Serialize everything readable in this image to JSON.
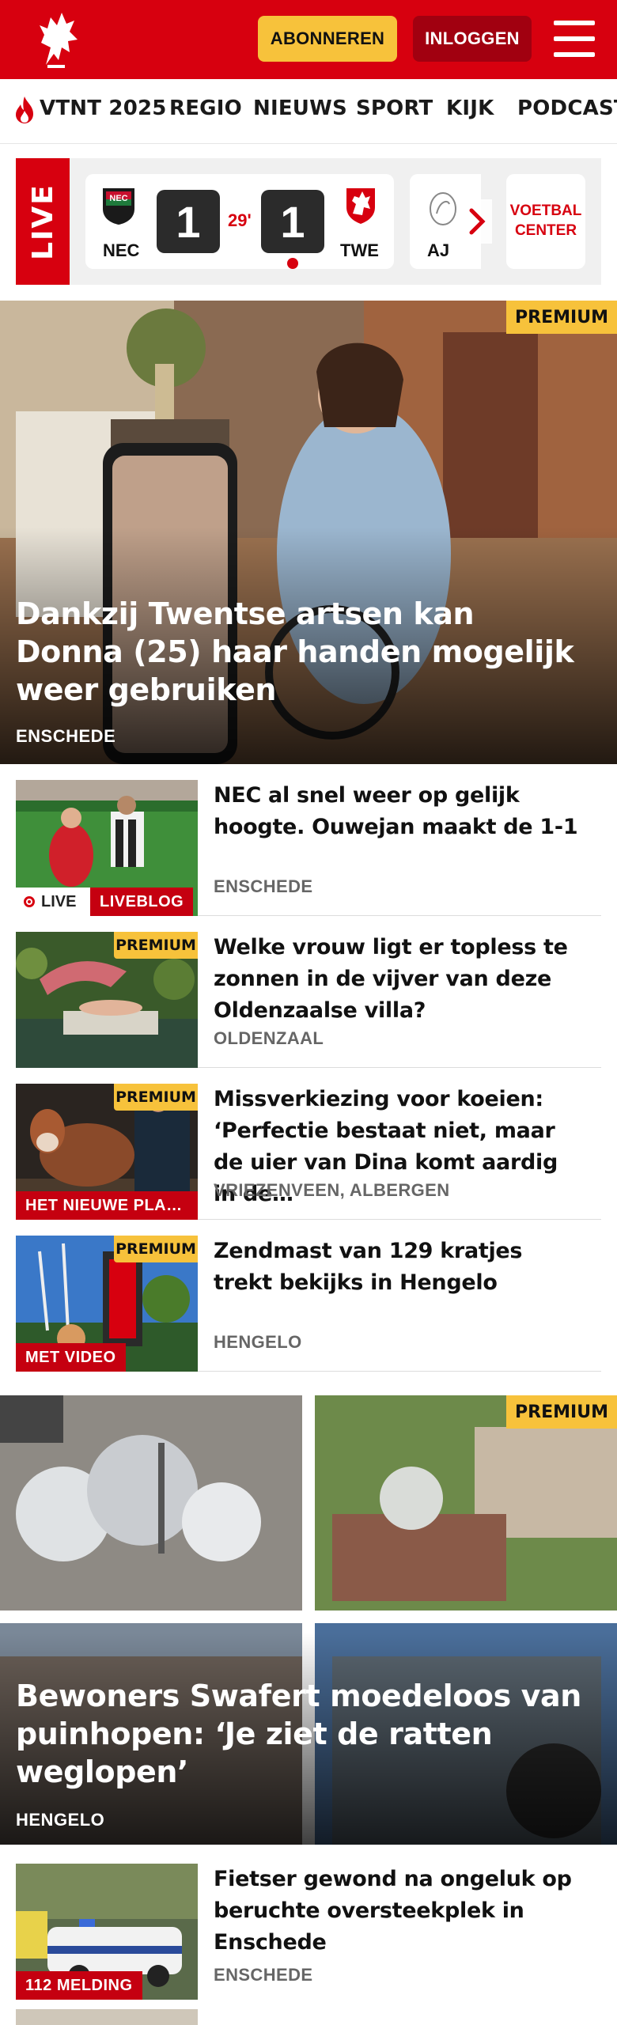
{
  "header": {
    "subscribe_label": "ABONNEREN",
    "login_label": "INLOGGEN",
    "brand_color": "#d7000f"
  },
  "nav": {
    "items": [
      "VTNT 2025",
      "REGIO",
      "NIEUWS",
      "SPORT",
      "KIJK",
      "PODCAST"
    ]
  },
  "live": {
    "label": "LIVE",
    "match": {
      "home": "NEC",
      "away": "TWE",
      "home_score": "1",
      "away_score": "1",
      "minute": "29'"
    },
    "next_team": "AJ",
    "voetbal_center": "VOETBAL CENTER"
  },
  "hero": {
    "badge": "PREMIUM",
    "title": "Dankzij Twentse artsen kan Donna (25) haar handen mogelijk weer gebruiken",
    "region": "ENSCHEDE"
  },
  "articles": [
    {
      "title": "NEC al snel weer op gelijk hoogte. Ouwejan maakt de 1-1",
      "region": "ENSCHEDE",
      "live": "LIVE",
      "label": "LIVEBLOG"
    },
    {
      "badge": "PREMIUM",
      "title": "Welke vrouw ligt er topless te zonnen in de vijver van deze Oldenzaalse villa?",
      "region": "OLDENZAAL"
    },
    {
      "badge": "PREMIUM",
      "title": "Missverkiezing voor koeien: ‘Perfectie bestaat niet, maar de uier van Dina komt aardig in de…",
      "region": "VRIEZENVEEN, ALBERGEN",
      "label": "HET NIEUWE PLA…"
    },
    {
      "badge": "PREMIUM",
      "title": "Zendmast van 129 kratjes trekt bekijks in Hengelo",
      "region": "HENGELO",
      "label": "MET VIDEO"
    }
  ],
  "collage": {
    "badge": "PREMIUM",
    "title": "Bewoners Swafert moedeloos van puinhopen: ‘Je ziet de ratten weglopen’",
    "region": "HENGELO"
  },
  "article_last": {
    "title": "Fietser gewond na ongeluk op beruchte oversteekplek in Enschede",
    "region": "ENSCHEDE",
    "label": "112 MELDING"
  }
}
